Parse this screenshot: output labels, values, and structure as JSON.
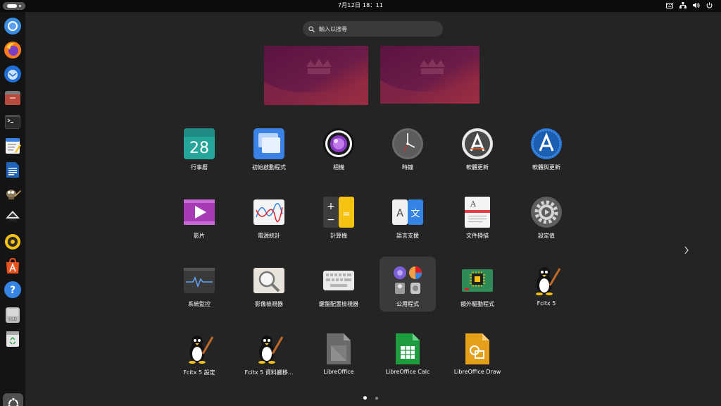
{
  "topbar": {
    "clock": "7月12日 18：11",
    "activities_label": "",
    "status_icons": [
      "keyboard-indicator-icon",
      "network-icon",
      "volume-icon",
      "power-icon"
    ]
  },
  "dock": {
    "items": [
      {
        "name": "chromium"
      },
      {
        "name": "firefox"
      },
      {
        "name": "thunderbird"
      },
      {
        "name": "files"
      },
      {
        "name": "terminal"
      },
      {
        "name": "text-editor"
      },
      {
        "name": "libreoffice-writer"
      },
      {
        "name": "gimp"
      },
      {
        "name": "inkscape"
      },
      {
        "name": "rhythmbox"
      },
      {
        "name": "app-center"
      },
      {
        "name": "help"
      },
      {
        "name": "ssd-drive",
        "text": "SSD"
      },
      {
        "name": "trash"
      }
    ]
  },
  "search": {
    "placeholder": "輸入以搜尋"
  },
  "apps": [
    {
      "label": "行事曆",
      "icon": "calendar-icon",
      "day": "28"
    },
    {
      "label": "初始啟動程式",
      "icon": "startup-applications-icon"
    },
    {
      "label": "相機",
      "icon": "camera-icon"
    },
    {
      "label": "時鐘",
      "icon": "clock-icon"
    },
    {
      "label": "軟體更新",
      "icon": "software-updater-icon"
    },
    {
      "label": "軟體與更新",
      "icon": "software-properties-icon"
    },
    {
      "label": "影片",
      "icon": "videos-icon"
    },
    {
      "label": "電源統計",
      "icon": "power-statistics-icon"
    },
    {
      "label": "計算機",
      "icon": "calculator-icon"
    },
    {
      "label": "語言支援",
      "icon": "language-support-icon"
    },
    {
      "label": "文件掃描",
      "icon": "document-scanner-icon"
    },
    {
      "label": "設定值",
      "icon": "settings-icon"
    },
    {
      "label": "系統監控",
      "icon": "system-monitor-icon"
    },
    {
      "label": "影像檢視器",
      "icon": "image-viewer-icon"
    },
    {
      "label": "鍵盤配置檢視器",
      "icon": "keyboard-layout-icon"
    },
    {
      "label": "公用程式",
      "icon": "utilities-folder-icon"
    },
    {
      "label": "額外驅動程式",
      "icon": "additional-drivers-icon"
    },
    {
      "label": "Fcitx 5",
      "icon": "fcitx-penguin-icon"
    },
    {
      "label": "Fcitx 5 設定",
      "icon": "fcitx-penguin-icon"
    },
    {
      "label": "Fcitx 5 資料搬移...",
      "icon": "fcitx-penguin-icon"
    },
    {
      "label": "LibreOffice",
      "icon": "libreoffice-icon"
    },
    {
      "label": "LibreOffice Calc",
      "icon": "libreoffice-calc-icon"
    },
    {
      "label": "LibreOffice Draw",
      "icon": "libreoffice-draw-icon"
    }
  ],
  "calc_icon_text": [
    "+",
    "=",
    "−"
  ],
  "lang_icon_text": [
    "A",
    "文"
  ],
  "scan_icon_text": "A",
  "pager": {
    "pages": 2,
    "current": 1
  },
  "colors": {
    "accent": "#e95420",
    "background": "#242424",
    "panel": "#0c0c0c"
  }
}
